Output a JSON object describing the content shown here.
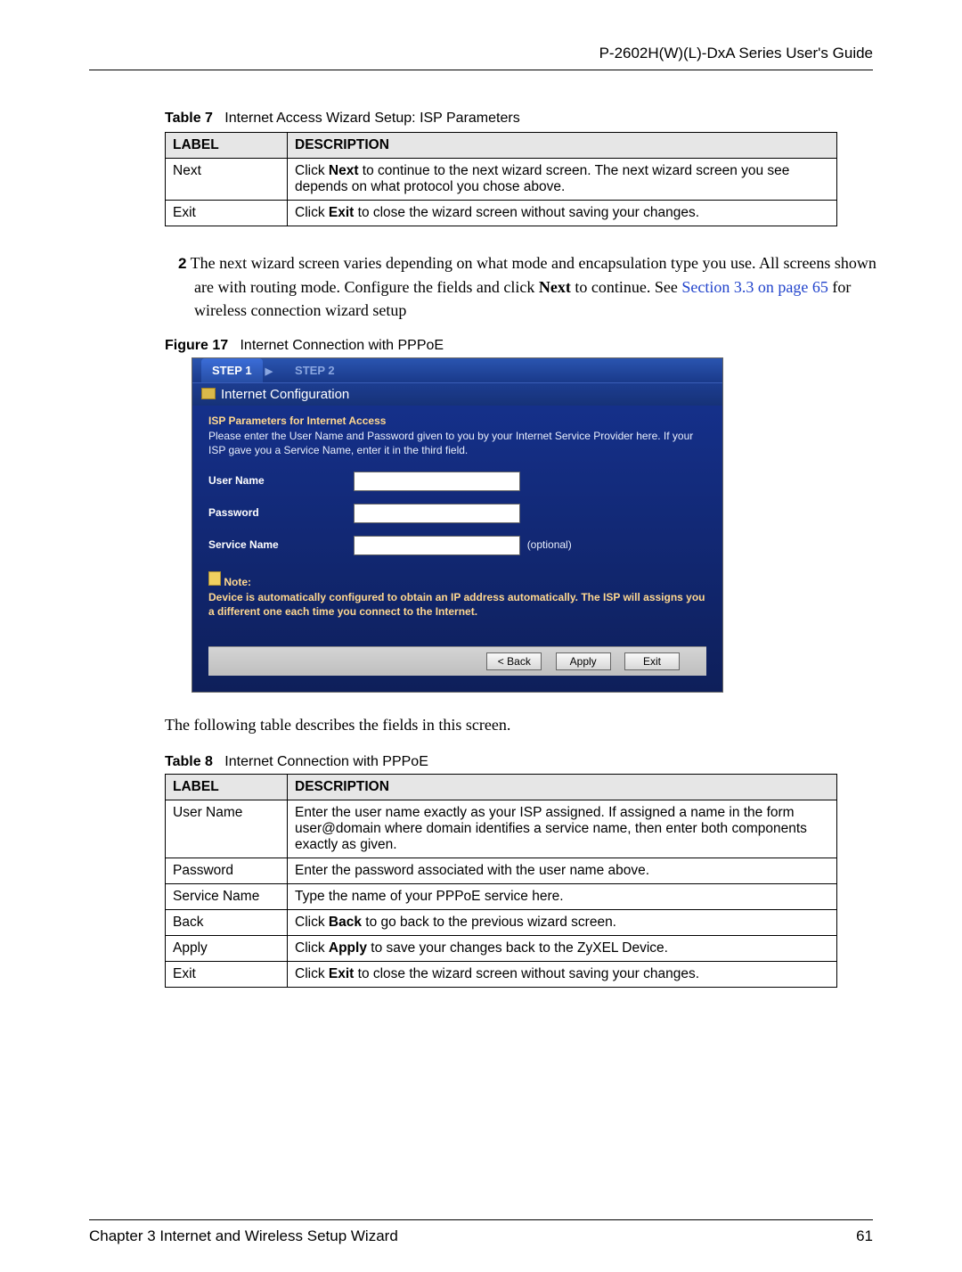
{
  "header": {
    "right": "P-2602H(W)(L)-DxA Series User's Guide"
  },
  "table7": {
    "title_prefix": "Table 7",
    "title_text": "Internet Access Wizard Setup: ISP Parameters",
    "col_label": "LABEL",
    "col_desc": "DESCRIPTION",
    "rows": [
      {
        "label": "Next",
        "desc_pre": "Click ",
        "desc_bold": "Next",
        "desc_post": " to continue to the next wizard screen. The next wizard screen you see depends on what protocol you chose above."
      },
      {
        "label": "Exit",
        "desc_pre": "Click ",
        "desc_bold": "Exit",
        "desc_post": " to close the wizard screen without saving your changes."
      }
    ]
  },
  "para2": {
    "num": "2",
    "text_l1": "The next wizard screen varies depending on what mode and encapsulation type you use. All screens shown are with routing mode. Configure the fields and click ",
    "text_bold": "Next",
    "text_l2": " to continue. See ",
    "xref": "Section 3.3 on page 65",
    "text_l3": " for wireless connection wizard setup"
  },
  "fig17": {
    "title_prefix": "Figure 17",
    "title_text": "Internet Connection with PPPoE"
  },
  "wizard": {
    "step1": "STEP 1",
    "step2": "STEP 2",
    "heading": "Internet Configuration",
    "isp_title": "ISP Parameters for Internet Access",
    "isp_desc": "Please enter the User Name and Password given to you by your Internet Service Provider here. If your ISP gave you a Service Name, enter it in the third field.",
    "label_user": "User Name",
    "label_pass": "Password",
    "label_service": "Service Name",
    "optional": "(optional)",
    "note_label": "Note:",
    "note_text": "Device is automatically configured to obtain an IP address automatically. The ISP will assigns you a different one each time you connect to the Internet.",
    "btn_back": "< Back",
    "btn_apply": "Apply",
    "btn_exit": "Exit"
  },
  "body_after": "The following table describes the fields in this screen.",
  "table8": {
    "title_prefix": "Table 8",
    "title_text": "Internet Connection with PPPoE",
    "col_label": "LABEL",
    "col_desc": "DESCRIPTION",
    "rows": [
      {
        "label": "User Name",
        "desc_pre": "Enter the user name exactly as your ISP assigned. If assigned a name in the form user@domain where domain identifies a service name, then enter both components exactly as given.",
        "desc_bold": "",
        "desc_post": ""
      },
      {
        "label": "Password",
        "desc_pre": "Enter the password associated with the user name above.",
        "desc_bold": "",
        "desc_post": ""
      },
      {
        "label": "Service Name",
        "desc_pre": "Type the name of your PPPoE service here.",
        "desc_bold": "",
        "desc_post": ""
      },
      {
        "label": "Back",
        "desc_pre": "Click ",
        "desc_bold": "Back",
        "desc_post": " to go back to the previous wizard screen."
      },
      {
        "label": "Apply",
        "desc_pre": "Click ",
        "desc_bold": "Apply",
        "desc_post": " to save your changes back to the ZyXEL Device."
      },
      {
        "label": "Exit",
        "desc_pre": "Click ",
        "desc_bold": "Exit",
        "desc_post": " to close the wizard screen without saving your changes."
      }
    ]
  },
  "footer": {
    "left": "Chapter 3 Internet and Wireless Setup Wizard",
    "right": "61"
  }
}
